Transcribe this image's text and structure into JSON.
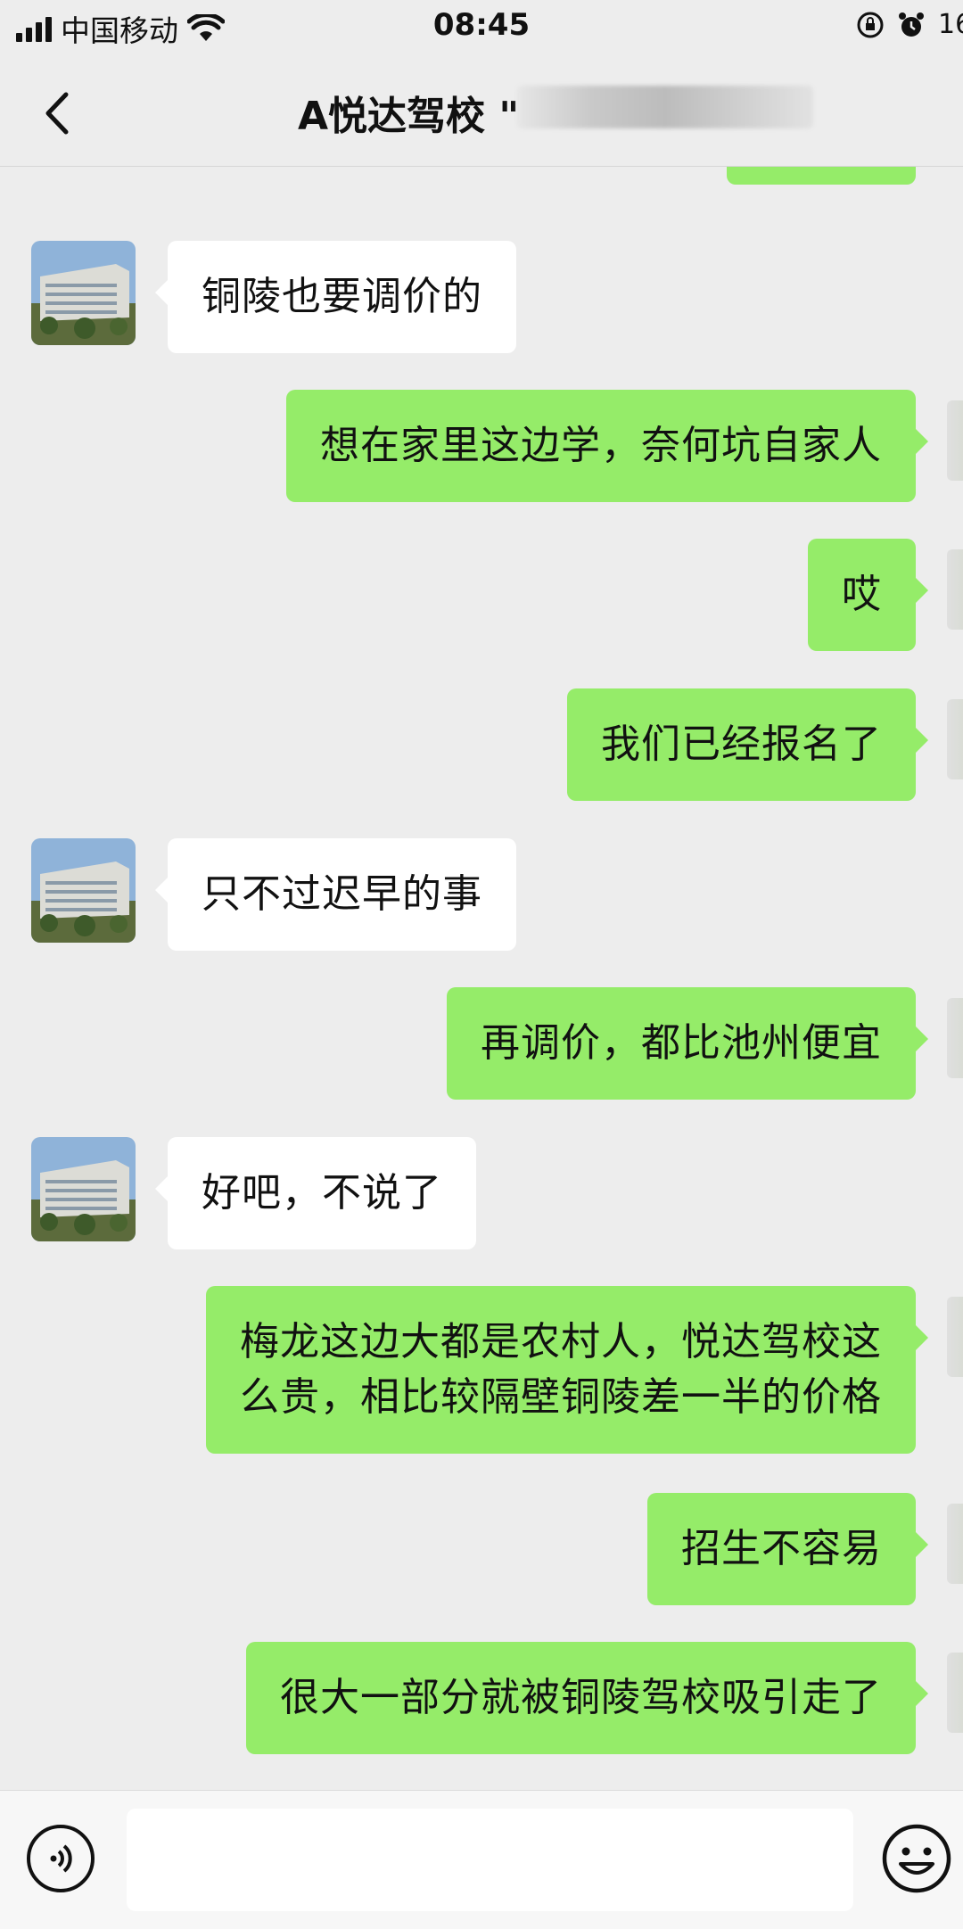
{
  "status_bar": {
    "carrier": "中国移动",
    "time": "08:45",
    "battery": "16"
  },
  "header": {
    "title": "A悦达驾校 \"",
    "back_icon": "chevron-left-icon"
  },
  "messages": [
    {
      "side": "in",
      "text": "铜陵也要调价的"
    },
    {
      "side": "out",
      "text": "想在家里这边学，奈何坑自家人"
    },
    {
      "side": "out",
      "text": "哎"
    },
    {
      "side": "out",
      "text": "我们已经报名了"
    },
    {
      "side": "in",
      "text": "只不过迟早的事"
    },
    {
      "side": "out",
      "text": "再调价，都比池州便宜"
    },
    {
      "side": "in",
      "text": "好吧，不说了"
    },
    {
      "side": "out",
      "text": "梅龙这边大都是农村人，悦达驾校这\n么贵，相比较隔壁铜陵差一半的价格"
    },
    {
      "side": "out",
      "text": "招生不容易"
    },
    {
      "side": "out",
      "text": "很大一部分就被铜陵驾校吸引走了"
    }
  ],
  "input_bar": {
    "voice_icon": "voice-icon",
    "emoji_icon": "emoji-icon",
    "value": ""
  },
  "colors": {
    "background": "#ededed",
    "outgoing_bubble": "#95ec69",
    "incoming_bubble": "#ffffff"
  }
}
